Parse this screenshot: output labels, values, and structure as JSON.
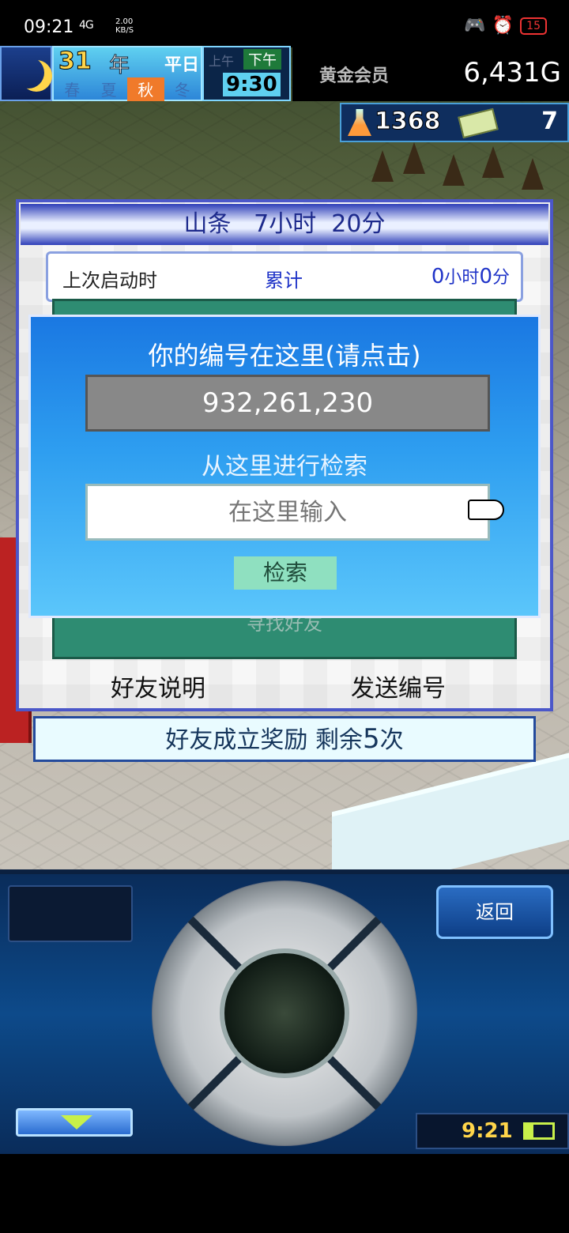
{
  "status_bar": {
    "time": "09:21",
    "network": "4G",
    "speed_value": "2.00",
    "speed_unit": "KB/S",
    "battery": "15"
  },
  "hud": {
    "year_number": "31",
    "year_label": "年",
    "day_type": "平日",
    "season_labels": [
      "春",
      "夏",
      "秋",
      "冬"
    ],
    "active_season": "秋",
    "am_label": "上午",
    "pm_label": "下午",
    "clock": "9:30",
    "member_label": "黄金会员",
    "gold": "6,431G",
    "research_points": "1368",
    "tickets": "7"
  },
  "friend_panel": {
    "header_name": "山条",
    "header_hours": "7",
    "header_hours_unit": "小时",
    "header_minutes": "20",
    "header_minutes_unit": "分",
    "last_launch_label": "上次启动时",
    "total_label": "累计",
    "total_hours": "0",
    "total_hours_unit": "小时",
    "total_minutes": "0",
    "total_minutes_unit": "分",
    "behind_dialog_text": "寻找好友",
    "friend_explain_btn": "好友说明",
    "send_id_btn": "发送编号"
  },
  "id_dialog": {
    "title": "你的编号在这里(请点击)",
    "id_value": "932,261,230",
    "search_title": "从这里进行检索",
    "search_placeholder": "在这里输入",
    "search_button": "检索"
  },
  "bonus_bar": {
    "text": "好友成立奖励 剩余",
    "count": "5",
    "unit": "次"
  },
  "controller": {
    "back_button": "返回",
    "mini_clock": "9:21"
  },
  "colors": {
    "panel_border": "#4b57c9",
    "dialog_blue": "#2e9ef0",
    "id_box_gray": "#888888",
    "search_btn_green": "#8fe0c0",
    "gold_text": "#ffffff"
  }
}
